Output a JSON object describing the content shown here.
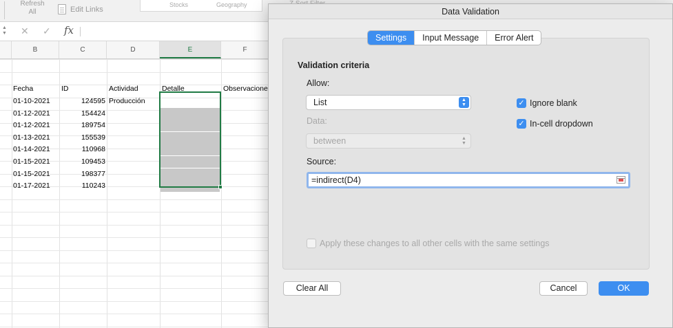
{
  "ribbon": {
    "refresh_all_label": "Refresh\nAll",
    "edit_links_label": "Edit Links",
    "data_types": [
      "Stocks",
      "Geography"
    ],
    "sort_label": "Z   Sort   Filter"
  },
  "formula_bar": {
    "cancel_glyph": "✕",
    "enter_glyph": "✓",
    "fx_label": "fx"
  },
  "columns": [
    "B",
    "C",
    "D",
    "E",
    "F"
  ],
  "sheet": {
    "headers": [
      "Fecha",
      "ID",
      "Actividad",
      "Detalle",
      "Observaciones"
    ],
    "rows": [
      {
        "fecha": "01-10-2021",
        "id": "124595",
        "actividad": "Producción"
      },
      {
        "fecha": "01-12-2021",
        "id": "154424",
        "actividad": ""
      },
      {
        "fecha": "01-12-2021",
        "id": "189754",
        "actividad": ""
      },
      {
        "fecha": "01-13-2021",
        "id": "155539",
        "actividad": ""
      },
      {
        "fecha": "01-14-2021",
        "id": "110968",
        "actividad": ""
      },
      {
        "fecha": "01-15-2021",
        "id": "109453",
        "actividad": ""
      },
      {
        "fecha": "01-15-2021",
        "id": "198377",
        "actividad": ""
      },
      {
        "fecha": "01-17-2021",
        "id": "110243",
        "actividad": ""
      }
    ]
  },
  "dialog": {
    "title": "Data Validation",
    "tabs": [
      {
        "label": "Settings",
        "active": true
      },
      {
        "label": "Input Message",
        "active": false
      },
      {
        "label": "Error Alert",
        "active": false
      }
    ],
    "section_title": "Validation criteria",
    "allow_label": "Allow:",
    "allow_value": "List",
    "data_label": "Data:",
    "data_value": "between",
    "ignore_blank_label": "Ignore blank",
    "ignore_blank_checked": true,
    "in_cell_dropdown_label": "In-cell dropdown",
    "in_cell_dropdown_checked": true,
    "source_label": "Source:",
    "source_value": "=indirect(D4)",
    "apply_all_label": "Apply these changes to all other cells with the same settings",
    "apply_all_checked": false,
    "clear_all_label": "Clear All",
    "cancel_label": "Cancel",
    "ok_label": "OK"
  },
  "colors": {
    "accent": "#3d8ef0",
    "selection": "#1f7a43"
  }
}
